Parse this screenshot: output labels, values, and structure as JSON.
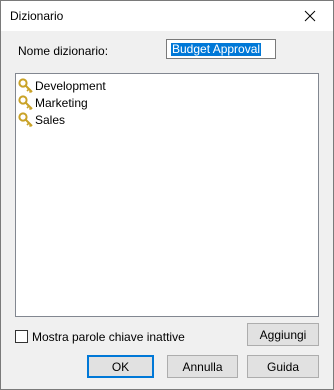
{
  "window": {
    "title": "Dizionario"
  },
  "form": {
    "name_label": "Nome dizionario:",
    "name_value": "Budget Approval"
  },
  "keywords": [
    {
      "label": "Development",
      "icon": "key-icon"
    },
    {
      "label": "Marketing",
      "icon": "key-icon"
    },
    {
      "label": "Sales",
      "icon": "key-icon"
    }
  ],
  "options": {
    "show_inactive_label": "Mostra parole chiave inattive",
    "show_inactive_checked": false
  },
  "buttons": {
    "add": "Aggiungi",
    "ok": "OK",
    "cancel": "Annulla",
    "help": "Guida"
  },
  "colors": {
    "accent": "#0078d7",
    "key_icon": "#c9a227"
  }
}
